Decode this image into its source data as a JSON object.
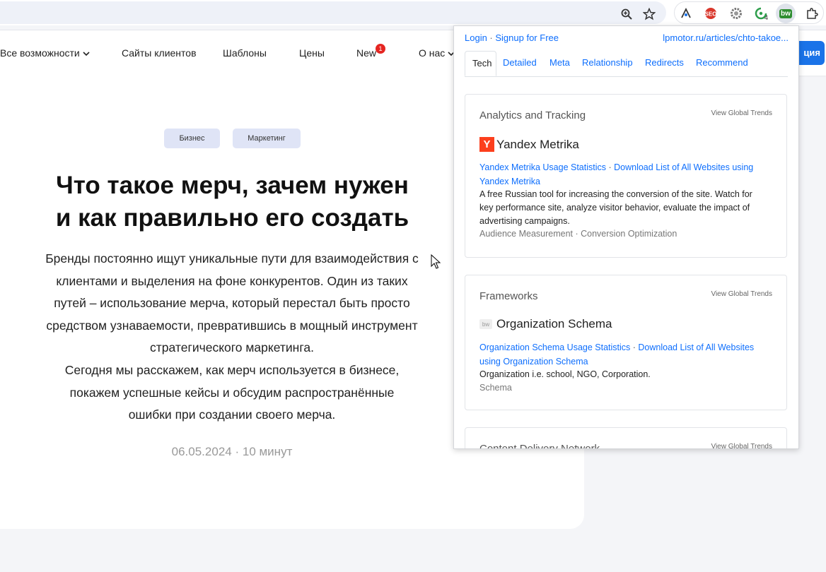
{
  "browser": {
    "ext_badge": "4",
    "ext_active_label": "bw"
  },
  "nav": {
    "features": "Все возможности",
    "clients": "Сайты клиентов",
    "templates": "Шаблоны",
    "prices": "Цены",
    "new": "New",
    "new_badge": "1",
    "about": "О нас",
    "cta": "ция"
  },
  "article": {
    "tags": [
      "Бизнес",
      "Маркетинг"
    ],
    "title_line1": "Что такое мерч, зачем нужен",
    "title_line2": "и как правильно его создать",
    "lead_lines": [
      "Бренды постоянно ищут уникальные пути для взаимодействия с",
      "клиентами и выделения на фоне конкурентов. Один из таких",
      "путей – использование мерча, который перестал быть просто",
      "средством узнаваемости, превратившись в мощный инструмент",
      "стратегического маркетинга.",
      "Сегодня мы расскажем, как мерч используется в бизнесе,",
      "покажем успешные кейсы и обсудим распространённые",
      "ошибки при создании своего мерча."
    ],
    "date": "06.05.2024",
    "read_time": "10 минут"
  },
  "popup": {
    "login": "Login",
    "signup": "Signup for Free",
    "url": "lpmotor.ru/articles/chto-takoe...",
    "tabs": [
      "Tech",
      "Detailed",
      "Meta",
      "Relationship",
      "Redirects",
      "Recommend"
    ],
    "active_tab": "Tech",
    "cards": [
      {
        "heading": "Analytics and Tracking",
        "trends": "View Global Trends",
        "tech_name": "Yandex Metrika",
        "logo_letter": "Y",
        "link1": "Yandex Metrika Usage Statistics",
        "link2": "Download List of All Websites using Yandex Metrika",
        "desc_lines": [
          "A free Russian tool for increasing the conversion of the site. Watch for",
          "key performance site, analyze visitor behavior, evaluate the impact of",
          "advertising campaigns."
        ],
        "categories": "Audience Measurement · Conversion Optimization"
      },
      {
        "heading": "Frameworks",
        "trends": "View Global Trends",
        "tech_name": "Organization Schema",
        "logo_letter": "bw",
        "link1": "Organization Schema Usage Statistics",
        "link2": "Download List of All Websites using Organization Schema",
        "desc_lines": [
          "Organization i.e. school, NGO, Corporation."
        ],
        "categories": "Schema"
      },
      {
        "heading": "Content Delivery Network",
        "trends": "View Global Trends"
      }
    ]
  },
  "colors": {
    "accent": "#0d6efd",
    "tag_bg": "#dfe4f6",
    "badge": "#e52521",
    "yandex": "#fc3f1d",
    "cta": "#1a73e8"
  }
}
